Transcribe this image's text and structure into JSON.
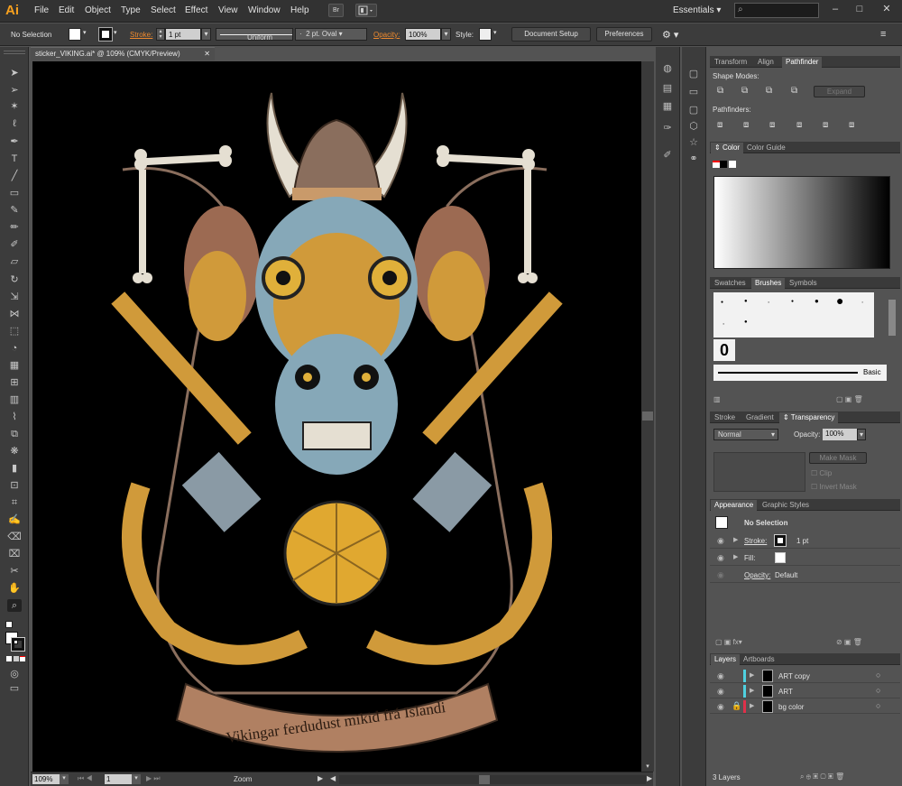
{
  "app": {
    "logo": "Ai"
  },
  "menu": [
    "File",
    "Edit",
    "Object",
    "Type",
    "Select",
    "Effect",
    "View",
    "Window",
    "Help"
  ],
  "menubar": {
    "bridge_label": "Br",
    "workspace": "Essentials",
    "search_placeholder": ""
  },
  "control": {
    "selection": "No Selection",
    "stroke_label": "Stroke:",
    "stroke_weight": "1 pt",
    "profile": "Uniform",
    "brush": "2 pt. Oval",
    "opacity_label": "Opacity:",
    "opacity": "100%",
    "style_label": "Style:",
    "document_setup": "Document Setup",
    "preferences": "Preferences"
  },
  "document": {
    "tab_title": "sticker_VIKING.ai* @ 109% (CMYK/Preview)",
    "artwork_banner": "Vikingar ferdudust mikid frá Islandi"
  },
  "status": {
    "zoom": "109%",
    "artboard": "1",
    "tool": "Zoom"
  },
  "panels": {
    "transform_tabs": [
      "Transform",
      "Align",
      "Pathfinder"
    ],
    "shape_modes": "Shape Modes:",
    "pathfinders": "Pathfinders:",
    "expand": "Expand",
    "color_tabs": [
      "Color",
      "Color Guide"
    ],
    "brush_tabs": [
      "Swatches",
      "Brushes",
      "Symbols"
    ],
    "brush_basic": "Basic",
    "transparency_tabs": [
      "Stroke",
      "Gradient",
      "Transparency"
    ],
    "blend_mode": "Normal",
    "opacity_label": "Opacity:",
    "opacity": "100%",
    "make_mask": "Make Mask",
    "clip": "Clip",
    "invert_mask": "Invert Mask",
    "appearance_tabs": [
      "Appearance",
      "Graphic Styles"
    ],
    "appearance_title": "No Selection",
    "stroke_label": "Stroke:",
    "stroke_value": "1 pt",
    "fill_label": "Fill:",
    "opacity_row_label": "Opacity:",
    "opacity_row_value": "Default",
    "layers_tabs": [
      "Layers",
      "Artboards"
    ],
    "layers": [
      {
        "name": "ART copy",
        "color": "#4fd1e0"
      },
      {
        "name": "ART",
        "color": "#4fd1e0"
      },
      {
        "name": "bg color",
        "color": "#e0304a"
      }
    ],
    "layers_count": "3 Layers"
  }
}
